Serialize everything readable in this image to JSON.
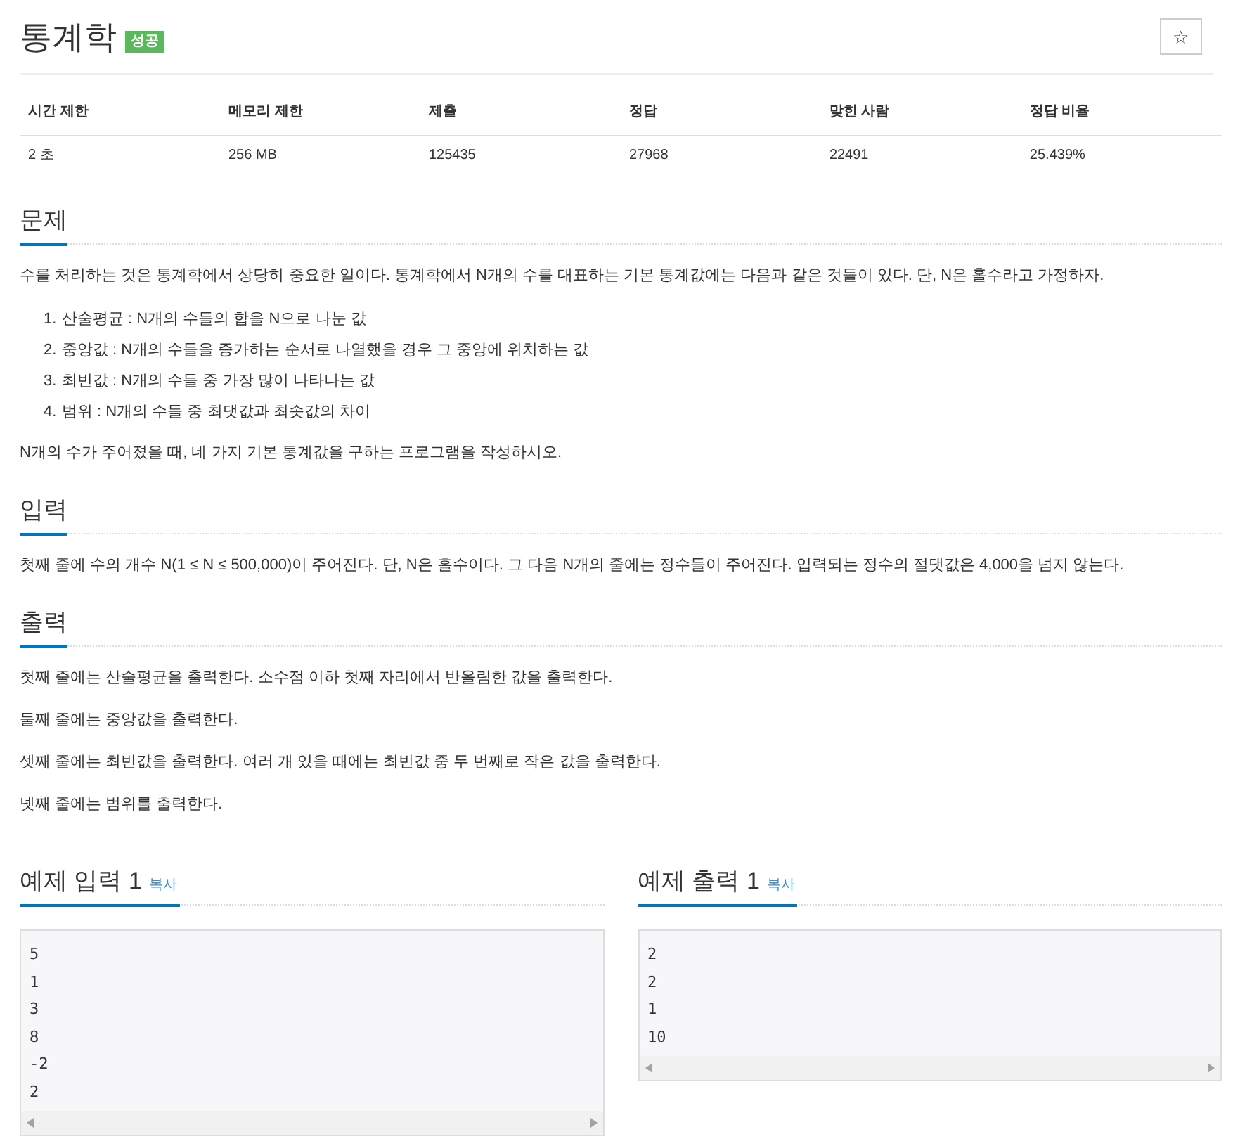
{
  "problem": {
    "title": "통계학",
    "badge": "성공",
    "star": "☆"
  },
  "info_table": {
    "columns": [
      "시간 제한",
      "메모리 제한",
      "제출",
      "정답",
      "맞힌 사람",
      "정답 비율"
    ],
    "rows": [
      [
        "2 초",
        "256 MB",
        "125435",
        "27968",
        "22491",
        "25.439%"
      ]
    ]
  },
  "sections": [
    {
      "heading": "문제",
      "paragraphs": [
        "수를 처리하는 것은 통계학에서 상당히 중요한 일이다. 통계학에서 N개의 수를 대표하는 기본 통계값에는 다음과 같은 것들이 있다. 단, N은 홀수라고 가정하자."
      ],
      "list": [
        {
          "number": "1.",
          "text": "산술평균 : N개의 수들의 합을 N으로 나눈 값"
        },
        {
          "number": "2.",
          "text": "중앙값 : N개의 수들을 증가하는 순서로 나열했을 경우 그 중앙에 위치하는 값"
        },
        {
          "number": "3.",
          "text": "최빈값 : N개의 수들 중 가장 많이 나타나는 값"
        },
        {
          "number": "4.",
          "text": "범위 : N개의 수들 중 최댓값과 최솟값의 차이"
        }
      ],
      "after": [
        "N개의 수가 주어졌을 때, 네 가지 기본 통계값을 구하는 프로그램을 작성하시오."
      ]
    },
    {
      "heading": "입력",
      "paragraphs": [
        "첫째 줄에 수의 개수 N(1 ≤ N ≤ 500,000)이 주어진다. 단, N은 홀수이다. 그 다음 N개의 줄에는 정수들이 주어진다. 입력되는 정수의 절댓값은 4,000을 넘지 않는다."
      ]
    },
    {
      "heading": "출력",
      "paragraphs": [
        "첫째 줄에는 산술평균을 출력한다. 소수점 이하 첫째 자리에서 반올림한 값을 출력한다.",
        "둘째 줄에는 중앙값을 출력한다.",
        "셋째 줄에는 최빈값을 출력한다. 여러 개 있을 때에는 최빈값 중 두 번째로 작은 값을 출력한다.",
        "넷째 줄에는 범위를 출력한다."
      ]
    }
  ],
  "samples": [
    {
      "heading": "예제 입력 1",
      "copy": "복사",
      "lines": [
        "5",
        "1",
        "3",
        "8",
        "-2",
        "2"
      ]
    },
    {
      "heading": "예제 출력 1",
      "copy": "복사",
      "lines": [
        "2",
        "2",
        "1",
        "10"
      ]
    }
  ]
}
